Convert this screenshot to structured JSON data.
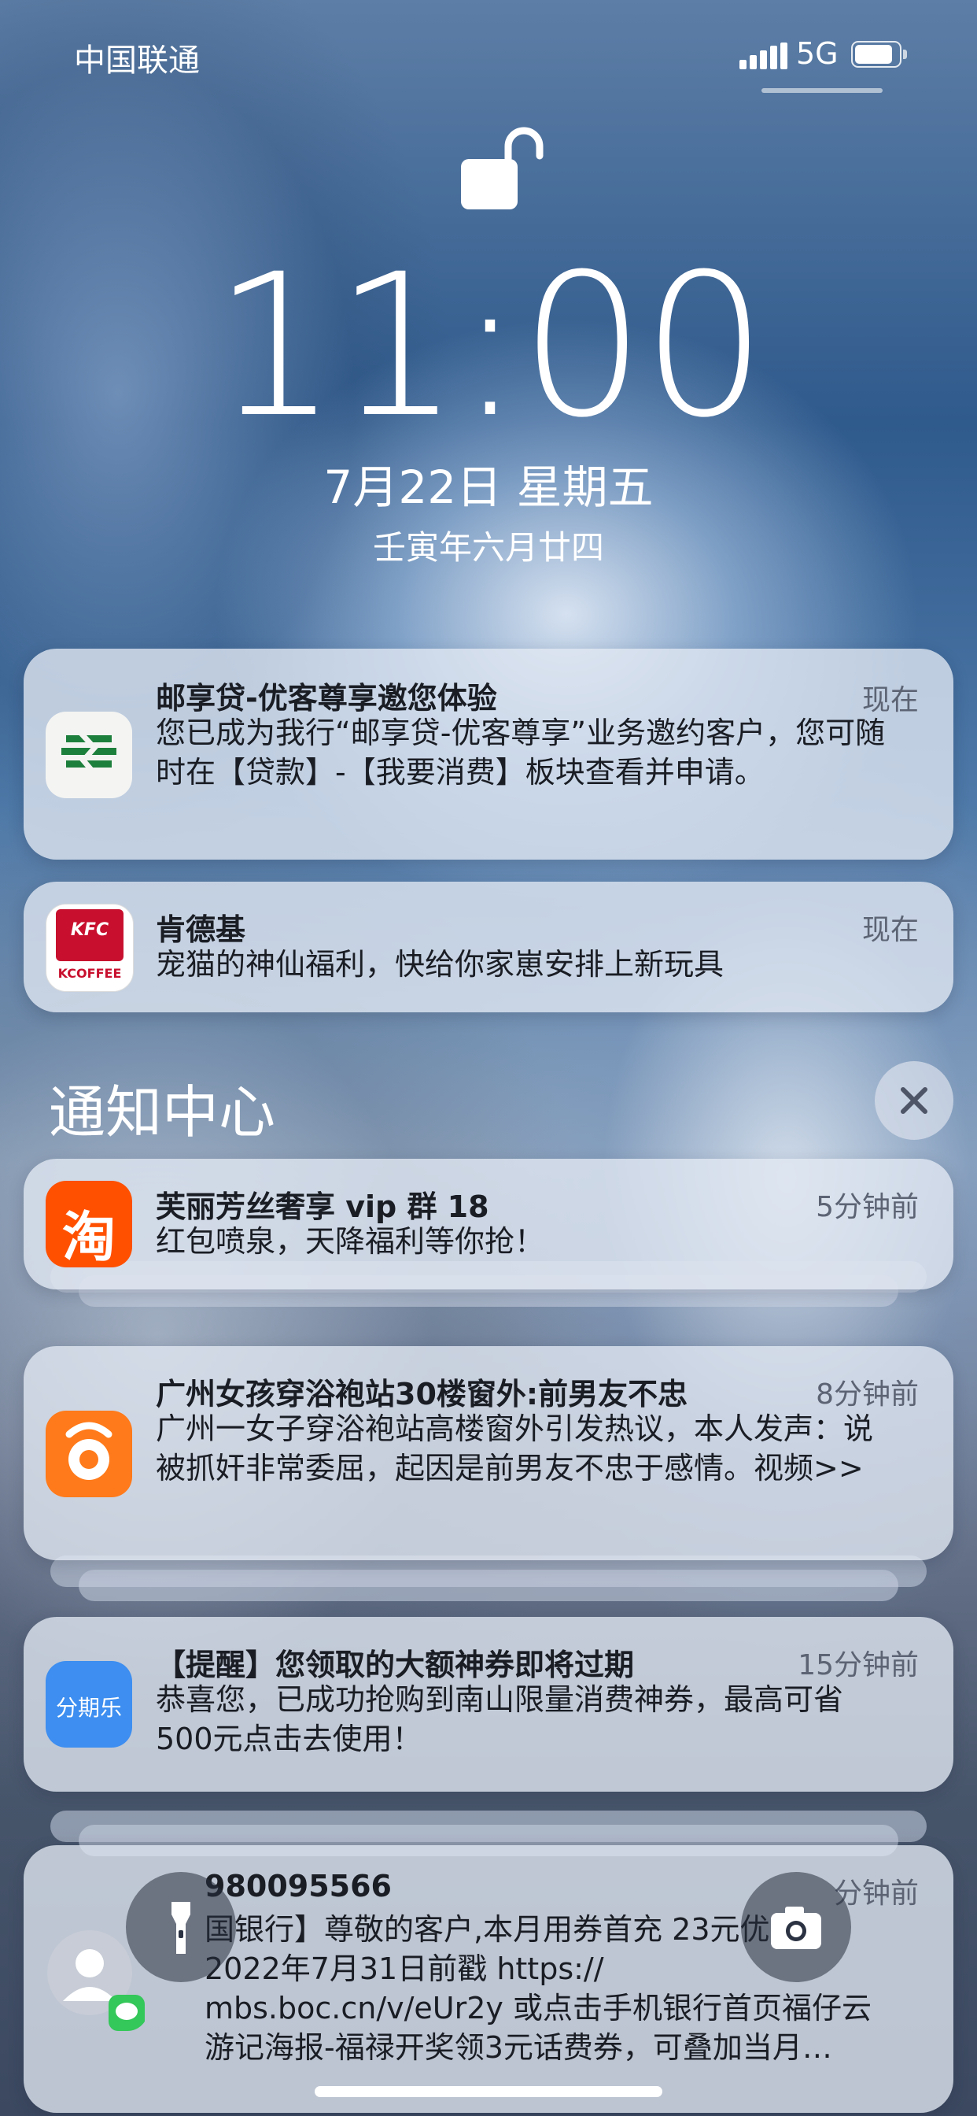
{
  "status_bar": {
    "carrier": "中国联通",
    "network": "5G",
    "battery_level": 0.9
  },
  "lock": {
    "time": "11:00",
    "date": "7月22日 星期五",
    "lunar_date": "壬寅年六月廿四"
  },
  "pinned_notifications": [
    {
      "app_icon": "psbc-bank-icon",
      "title": "邮享贷-优客尊享邀您体验",
      "time": "现在",
      "body": "您已成为我行“邮享贷-优客尊享”业务邀约客户，您可随时在【贷款】-【我要消费】板块查看并申请。"
    },
    {
      "app_icon": "kfc-icon",
      "icon_text_top": "KFC",
      "icon_text_bottom": "KCOFFEE",
      "title": "肯德基",
      "time": "现在",
      "body": "宠猫的神仙福利，快给你家崽安排上新玩具"
    }
  ],
  "notification_center": {
    "title": "通知中心",
    "close_label": "×",
    "items": [
      {
        "app_icon": "taobao-icon",
        "icon_glyph": "淘",
        "title": "芙丽芳丝奢享 vip 群 18",
        "time": "5分钟前",
        "body": "红包喷泉，天降福利等你抢！"
      },
      {
        "app_icon": "uc-browser-icon",
        "title": "广州女孩穿浴袍站30楼窗外:前男友不忠",
        "time": "8分钟前",
        "body": "广州一女子穿浴袍站高楼窗外引发热议，本人发声：说被抓奸非常委屈，起因是前男友不忠于感情。视频>>"
      },
      {
        "app_icon": "fenqile-icon",
        "icon_glyph": "分期乐",
        "title": "【提醒】您领取的大额神券即将过期",
        "time": "15分钟前",
        "body": "恭喜您，已成功抢购到南山限量消费神券，最高可省500元点击去使用！"
      },
      {
        "app_icon": "messages-contact-icon",
        "title": "980095566",
        "time": "分钟前",
        "body": "国银行】尊敬的客户,本月用券首充 23元优惠！2022年7月31日前戳 https:// mbs.boc.cn/v/eUr2y 或点击手机银行首页福仔云游记海报-福禄开奖领3元话费券，可叠加当月…"
      }
    ]
  },
  "quick_actions": {
    "left": "flashlight-icon",
    "right": "camera-icon"
  }
}
